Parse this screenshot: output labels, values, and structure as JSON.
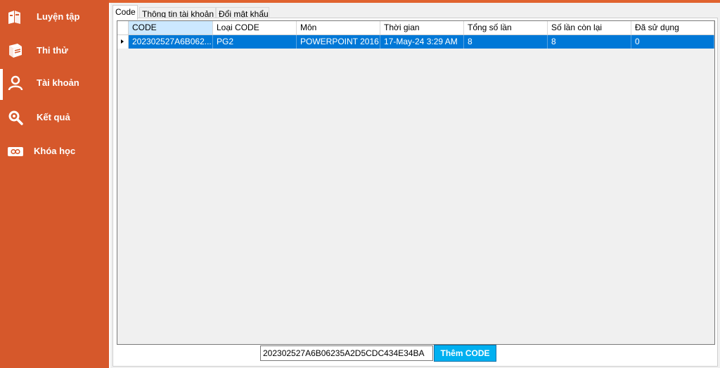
{
  "sidebar": {
    "items": [
      {
        "label": "Luyện tập",
        "icon": "books-icon"
      },
      {
        "label": "Thi thử",
        "icon": "book-icon"
      },
      {
        "label": "Tài khoản",
        "icon": "user-icon"
      },
      {
        "label": "Kết quả",
        "icon": "magnifier-icon"
      },
      {
        "label": "Khóa học",
        "icon": "course-icon"
      }
    ],
    "active": "Tài khoản"
  },
  "tabs": [
    {
      "label": "Code",
      "active": true
    },
    {
      "label": "Thông tin tài khoản",
      "active": false
    },
    {
      "label": "Đổi mật khẩu",
      "active": false
    }
  ],
  "grid": {
    "columns": [
      "CODE",
      "Loại CODE",
      "Môn",
      "Thời gian",
      "Tổng số lần",
      "Số lần còn lại",
      "Đã sử dụng"
    ],
    "rows": [
      [
        "202302527A6B062...",
        "PG2",
        "POWERPOINT 2016",
        "17-May-24 3:29 AM",
        "8",
        "8",
        "0"
      ]
    ]
  },
  "footer": {
    "code_value": "202302527A6B06235A2D5CDC434E34BA",
    "add_button": "Thêm CODE"
  },
  "colors": {
    "sidebar": "#D6582B",
    "selection": "#0078D7",
    "button": "#00B0F0"
  }
}
